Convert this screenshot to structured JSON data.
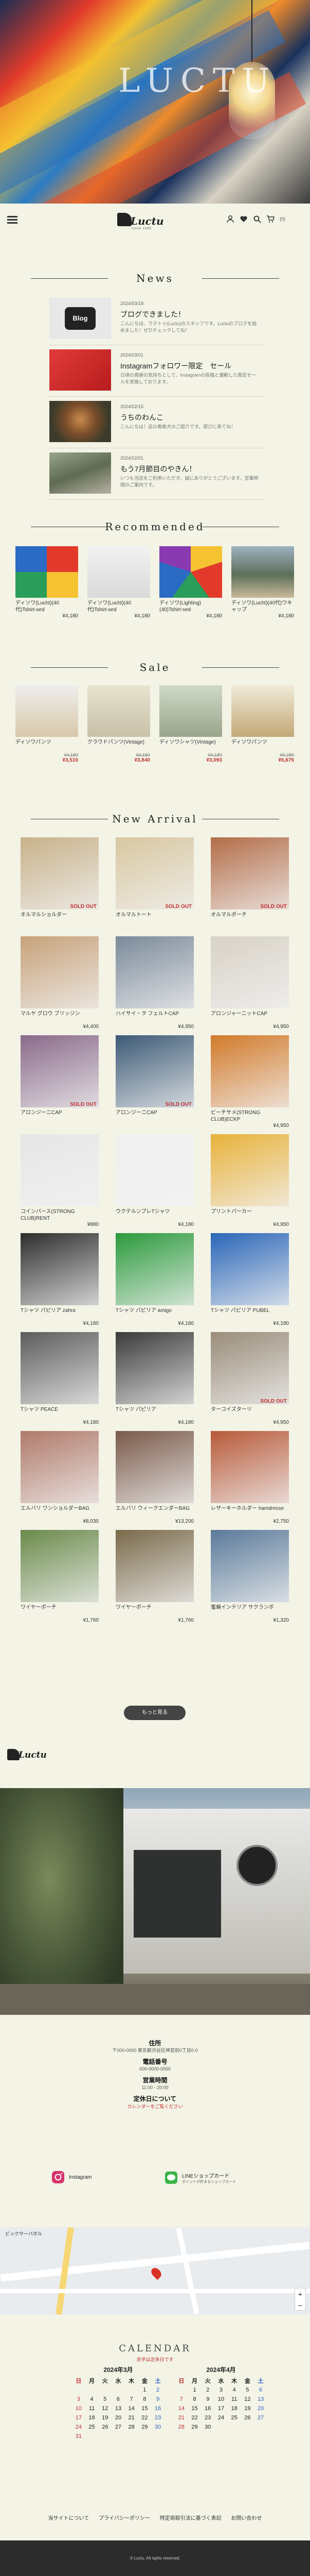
{
  "hero": {
    "sign_text": "LUCTU"
  },
  "header": {
    "logo_text": "Luctu",
    "logo_sub": "since 1985",
    "cart_count": "(0)"
  },
  "news": {
    "title": "News",
    "items": [
      {
        "date": "2024/03/18",
        "title": "ブログできました！",
        "excerpt": "こんにちは、ラクトゥ(Luctu)のスタッフです。Luctuのブログを始めました！ぜひチェックしてね！",
        "thumb": "Blog"
      },
      {
        "date": "2024/03/01",
        "title": "Instagramフォロワー限定　セール",
        "excerpt": "日頃の感謝の気持ちとして、Instagramの投稿と連動した限定セールを実施しております。",
        "thumb": ""
      },
      {
        "date": "2024/02/15",
        "title": "うちのわんこ",
        "excerpt": "こんにちは！店の看板犬のご紹介です。遊びに来てね！",
        "thumb": ""
      },
      {
        "date": "2024/02/01",
        "title": "もう7月節目のやきん！",
        "excerpt": "いつも当店をご利用いただき、誠にありがとうございます。営業時間のご案内です。",
        "thumb": ""
      }
    ]
  },
  "recommended": {
    "title": "Recommended",
    "items": [
      {
        "name": "ディソワ(Lucht)(40代)Tshirt-sed",
        "price": "¥4,180"
      },
      {
        "name": "ディソワ(Lucht)(40代)Tshirt-sed",
        "price": "¥4,180"
      },
      {
        "name": "ディソワ(Lighting)(40)Tshirt-sed",
        "price": "¥4,180"
      },
      {
        "name": "ディソワ(Lucht)(40代)ワキャップ",
        "price": "¥4,180"
      }
    ]
  },
  "sale": {
    "title": "Sale",
    "items": [
      {
        "name": "ディソワパンツ",
        "old": "¥4,180",
        "price": "¥3,510"
      },
      {
        "name": "クラウドパンツ(Vintage)",
        "old": "¥4,180",
        "price": "¥3,840"
      },
      {
        "name": "ディソワシャツ(Vintage)",
        "old": "¥4,180",
        "price": "¥3,093"
      },
      {
        "name": "ディソワパンツ",
        "old": "¥6,280",
        "price": "¥5,675"
      }
    ]
  },
  "arrival": {
    "title": "New Arrival",
    "sold_out": "SOLD OUT",
    "items": [
      {
        "name": "オルマルショルダー",
        "price": "",
        "sold": true
      },
      {
        "name": "オルマルトート",
        "price": "",
        "sold": true
      },
      {
        "name": "オルマルポーチ",
        "price": "",
        "sold": true
      },
      {
        "name": "マルヤ グロウ ブリッジン",
        "price": "¥4,400",
        "sold": false
      },
      {
        "name": "ハイサイ・ヲ フェルトCAP",
        "price": "¥4,950",
        "sold": false
      },
      {
        "name": "アロンジャーニットCAP",
        "price": "¥4,950",
        "sold": false
      },
      {
        "name": "アロンジーニCAP",
        "price": "",
        "sold": true
      },
      {
        "name": "アロンジーニCAP",
        "price": "",
        "sold": true
      },
      {
        "name": "ビーチサメ(STRONG CLUB)ECKP",
        "price": "¥4,950",
        "sold": false
      },
      {
        "name": "コインパース(STRONG CLUB)RENT",
        "price": "¥880",
        "sold": false
      },
      {
        "name": "ウクテルンプレTシャツ",
        "price": "¥4,180",
        "sold": false
      },
      {
        "name": "プリントパーカー",
        "price": "¥4,950",
        "sold": false
      },
      {
        "name": "Tシャツ パピリア zahra",
        "price": "¥4,180",
        "sold": false
      },
      {
        "name": "Tシャツ パピリア amigo",
        "price": "¥4,180",
        "sold": false
      },
      {
        "name": "Tシャツ パピリア PUBEL",
        "price": "¥4,180",
        "sold": false
      },
      {
        "name": "Tシャツ PEACE",
        "price": "¥4,180",
        "sold": false
      },
      {
        "name": "Tシャツ パピリア",
        "price": "¥4,180",
        "sold": false
      },
      {
        "name": "ターコイズターリ",
        "price": "¥4,950",
        "sold": true
      },
      {
        "name": "エルバリ ワンショルダーBAG",
        "price": "¥8,030",
        "sold": false
      },
      {
        "name": "エルバリ ウィークエンダーBAG",
        "price": "¥13,200",
        "sold": false
      },
      {
        "name": "レザーキーホルダー hamdresse",
        "price": "¥2,750",
        "sold": false
      },
      {
        "name": "ワイヤーポーチ",
        "price": "¥1,760",
        "sold": false
      },
      {
        "name": "ワイヤーポーチ",
        "price": "¥1,760",
        "sold": false
      },
      {
        "name": "蜜蝋インテリア サクランボ",
        "price": "¥1,320",
        "sold": false
      }
    ],
    "more_label": "もっと見る"
  },
  "shop_info": {
    "address_h": "住所",
    "address": "〒000-0000 東京都渋谷区神宮前0丁目0-0",
    "tel_h": "電話番号",
    "tel": "000-0000-0000",
    "hours_h": "営業時間",
    "hours": "11:00 - 20:00",
    "closed_h": "定休日について",
    "closed": "カレンダーをご覧ください"
  },
  "sns": {
    "instagram": "Instagram",
    "line": "LINEショップカード",
    "line_sub": "ポイントが貯まるショップカード"
  },
  "map": {
    "place": "ビックサーバボル",
    "rating": "4.0"
  },
  "calendar": {
    "title": "CALENDAR",
    "sub": "赤字は定休日です",
    "weekdays": [
      "日",
      "月",
      "火",
      "水",
      "木",
      "金",
      "土"
    ],
    "months": [
      {
        "label": "2024年3月",
        "rows": [
          [
            "",
            "",
            "",
            "",
            "",
            "1",
            "2"
          ],
          [
            "3",
            "4",
            "5",
            "6",
            "7",
            "8",
            "9"
          ],
          [
            "10",
            "11",
            "12",
            "13",
            "14",
            "15",
            "16"
          ],
          [
            "17",
            "18",
            "19",
            "20",
            "21",
            "22",
            "23"
          ],
          [
            "24",
            "25",
            "26",
            "27",
            "28",
            "29",
            "30"
          ],
          [
            "31",
            "",
            "",
            "",
            "",
            "",
            ""
          ]
        ]
      },
      {
        "label": "2024年4月",
        "rows": [
          [
            "",
            "1",
            "2",
            "3",
            "4",
            "5",
            "6"
          ],
          [
            "7",
            "8",
            "9",
            "10",
            "11",
            "12",
            "13"
          ],
          [
            "14",
            "15",
            "16",
            "17",
            "18",
            "19",
            "20"
          ],
          [
            "21",
            "22",
            "23",
            "24",
            "25",
            "26",
            "27"
          ],
          [
            "28",
            "29",
            "30",
            "",
            "",
            "",
            ""
          ]
        ]
      }
    ]
  },
  "footer": {
    "links": [
      "当サイトについて",
      "プライバシーポリシー",
      "特定商取引法に基づく表記",
      "お問い合わせ"
    ],
    "copy": "© Luctu. All rights reserved."
  }
}
